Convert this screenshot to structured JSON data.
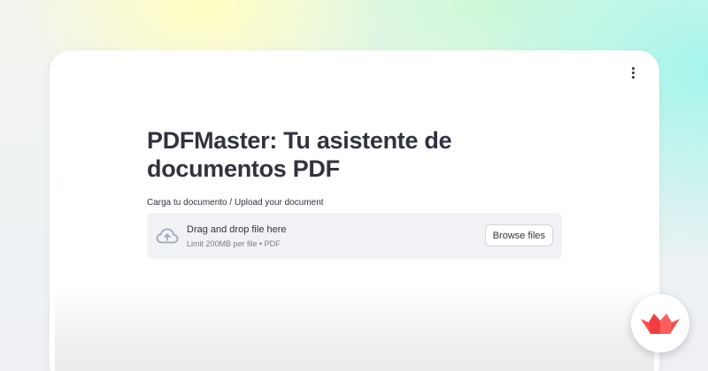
{
  "app": {
    "title": "PDFMaster: Tu asistente de documentos PDF"
  },
  "header": {
    "menu_icon": "vertical-ellipsis-icon"
  },
  "uploader": {
    "label": "Carga tu documento / Upload your document",
    "drop_title": "Drag and drop file here",
    "drop_limit": "Limit 200MB per file • PDF",
    "browse_label": "Browse files",
    "icon": "cloud-upload-icon"
  },
  "badge": {
    "icon": "streamlit-crown-logo"
  },
  "colors": {
    "text": "#31333f",
    "dropzone_bg": "#f0f2f6",
    "icon_gray": "#a3a8b8",
    "logo_red": "#ff4b4b"
  }
}
